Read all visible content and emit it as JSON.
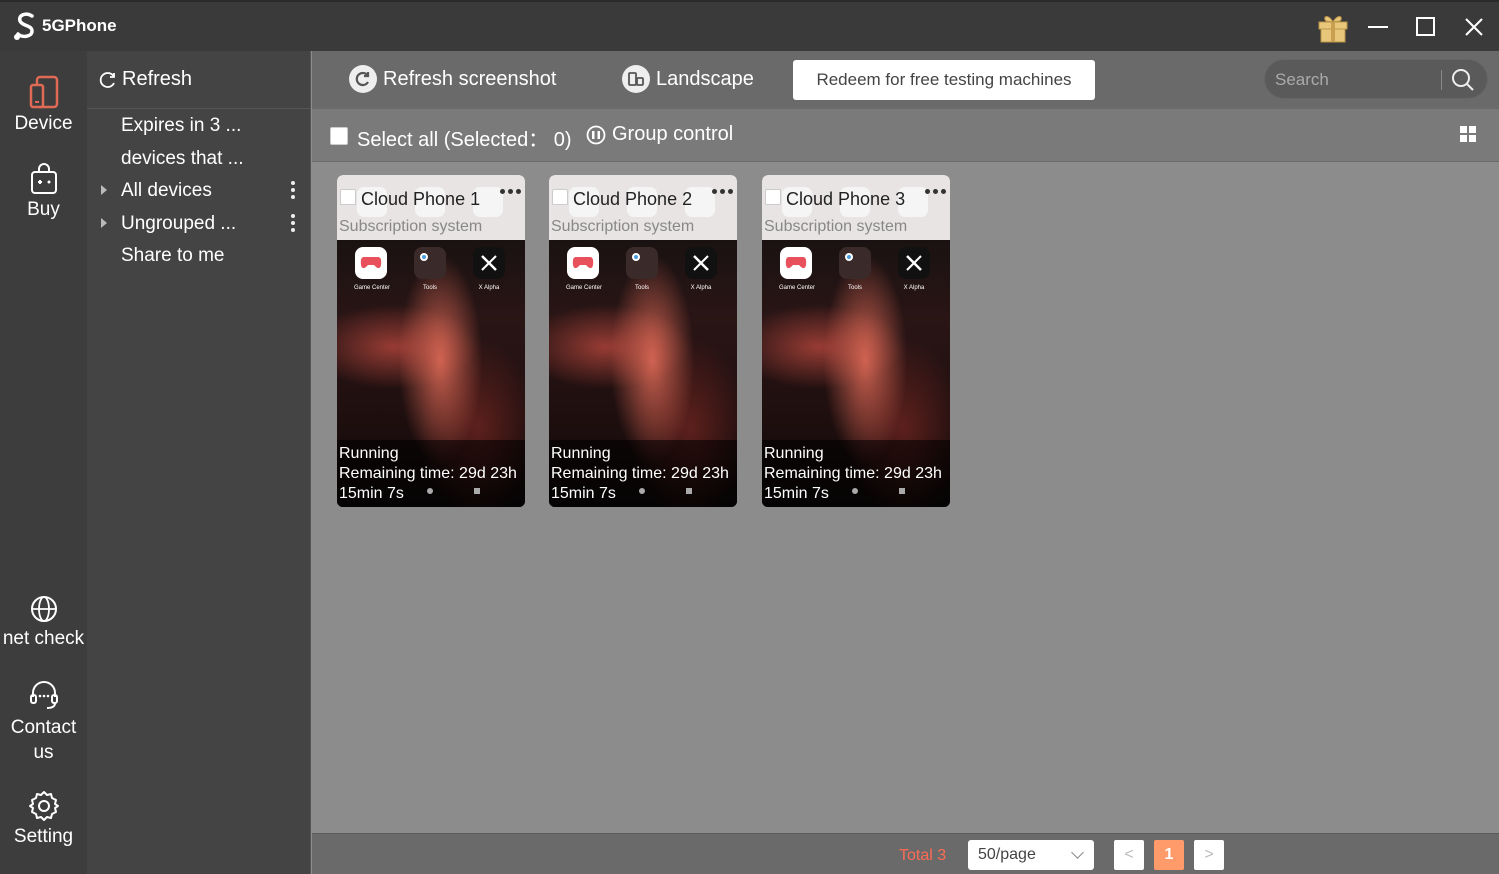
{
  "app": {
    "logo_text": "5GPhone"
  },
  "window": {
    "gift_icon": "gift-icon",
    "minimize": "minimize-icon",
    "maximize": "maximize-icon",
    "close": "close-icon"
  },
  "rail": {
    "device": "Device",
    "buy": "Buy",
    "net_check": "net check",
    "contact": "Contact us",
    "setting": "Setting"
  },
  "groups": {
    "refresh": "Refresh",
    "items": [
      {
        "label": "Expires in 3 ..."
      },
      {
        "label": "devices that ..."
      },
      {
        "label": "All devices"
      },
      {
        "label": "Ungrouped ..."
      },
      {
        "label": "Share to me"
      }
    ]
  },
  "toolbar": {
    "refresh_screenshot": "Refresh screenshot",
    "landscape": "Landscape",
    "redeem": "Redeem for free testing machines",
    "search_placeholder": "Search"
  },
  "subbar": {
    "select_all": "Select all (Selected： 0)",
    "group_control": "Group control"
  },
  "devices": [
    {
      "name": "Cloud Phone 1",
      "subtitle": "Subscription system",
      "status": "Running",
      "remaining": "Remaining time: 29d 23h",
      "remaining2": "15min 7s",
      "apps": [
        "Game Center",
        "Tools",
        "X Alpha"
      ]
    },
    {
      "name": "Cloud Phone 2",
      "subtitle": "Subscription system",
      "status": "Running",
      "remaining": "Remaining time: 29d 23h",
      "remaining2": "15min 7s",
      "apps": [
        "Game Center",
        "Tools",
        "X Alpha"
      ]
    },
    {
      "name": "Cloud Phone 3",
      "subtitle": "Subscription system",
      "status": "Running",
      "remaining": "Remaining time: 29d 23h",
      "remaining2": "15min 7s",
      "apps": [
        "Game Center",
        "Tools",
        "X Alpha"
      ]
    }
  ],
  "footer": {
    "total": "Total 3",
    "per_page": "50/page",
    "prev": "<",
    "page": "1",
    "next": ">"
  },
  "colors": {
    "accent": "#ff9a6a",
    "total_text": "#ff6a55",
    "device_icon": "#e06a55"
  }
}
